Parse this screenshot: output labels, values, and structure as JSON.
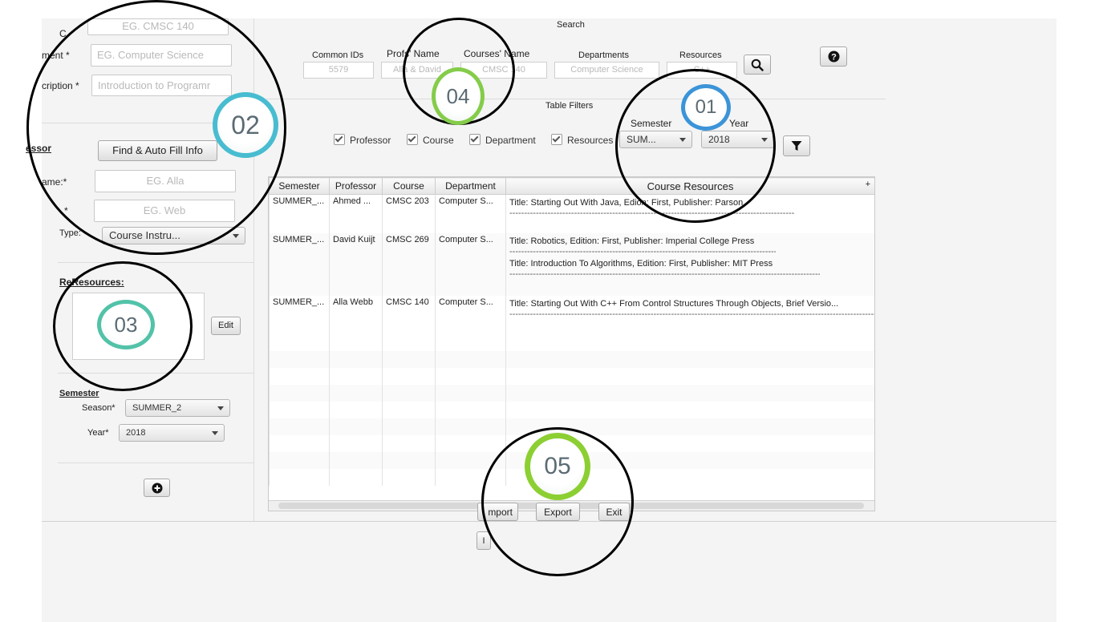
{
  "left_panel": {
    "course_id_label": "C",
    "course_id_placeholder": "EG. CMSC 140",
    "department_label": "ment *",
    "department_placeholder": "EG.  Computer Science",
    "description_label": "cription *",
    "description_placeholder": "Introduction to Programr",
    "professor_heading": "essor",
    "auto_fill_label": "Find & Auto Fill Info",
    "first_name_label": "ame:*",
    "first_name_placeholder": "EG. Alla",
    "last_name_label": "*",
    "last_name_placeholder": "EG. Web",
    "type_label": "Type:",
    "type_value": "Course Instru...",
    "resources_heading_prefix": "Re",
    "resources_heading": "Resources:",
    "edit_label": "Edit",
    "semester_heading": "Semester",
    "season_label": "Season*",
    "season_value": "SUMMER_2",
    "year_label": "Year*",
    "year_value": "2018",
    "add_icon": "plus-circle-icon"
  },
  "search": {
    "title": "Search",
    "common_ids_label": "Common IDs",
    "common_ids_placeholder": "5579",
    "profs_name_label": "Profs' Name",
    "profs_name_placeholder": "Alla & David",
    "courses_name_label": "Courses' Name",
    "courses_name_placeholder": "CMSC 140",
    "departments_label": "Departments",
    "departments_placeholder": "Computer Science",
    "resources_label": "Resources",
    "resources_placeholder": "C++",
    "search_icon": "magnifier-icon",
    "help_icon": "question-icon"
  },
  "filters": {
    "title": "Table Filters",
    "professor": "Professor",
    "course": "Course",
    "department": "Department",
    "resources": "Resources",
    "semester_label": "Semester",
    "semester_value": "SUM...",
    "year_label": "Year",
    "year_value": "2018",
    "filter_icon": "funnel-icon"
  },
  "table": {
    "headers": [
      "Semester",
      "Professor",
      "Course",
      "Department",
      "Course Resources"
    ],
    "plus": "+",
    "rows": [
      {
        "semester": "SUMMER_...",
        "professor": "Ahmed ...",
        "course": "CMSC 203",
        "department": "Computer S...",
        "resources": [
          "Title: Starting Out With Java, Edion: First, Publisher: Parson"
        ]
      },
      {
        "semester": "SUMMER_...",
        "professor": "David Kuijt",
        "course": "CMSC 269",
        "department": "Computer S...",
        "resources": [
          "Title: Robotics, Edition: First, Publisher: Imperial College Press",
          "Title: Introduction To Algorithms, Edition: First, Publisher: MIT Press"
        ]
      },
      {
        "semester": "SUMMER_...",
        "professor": "Alla Webb",
        "course": "CMSC 140",
        "department": "Computer S...",
        "resources": [
          "Title: Starting Out With C++ From Control Structures Through Objects, Brief Versio..."
        ]
      }
    ],
    "dash_line": "----------------------------------------------------------------------------------------------------------------------------------------------------------"
  },
  "footer": {
    "import_label": "mport",
    "export_label": "Export",
    "exit_label": "Exit",
    "lower_import_label": "I"
  },
  "callouts": {
    "c1": "01",
    "c2": "02",
    "c3": "03",
    "c4": "04",
    "c5": "05"
  }
}
